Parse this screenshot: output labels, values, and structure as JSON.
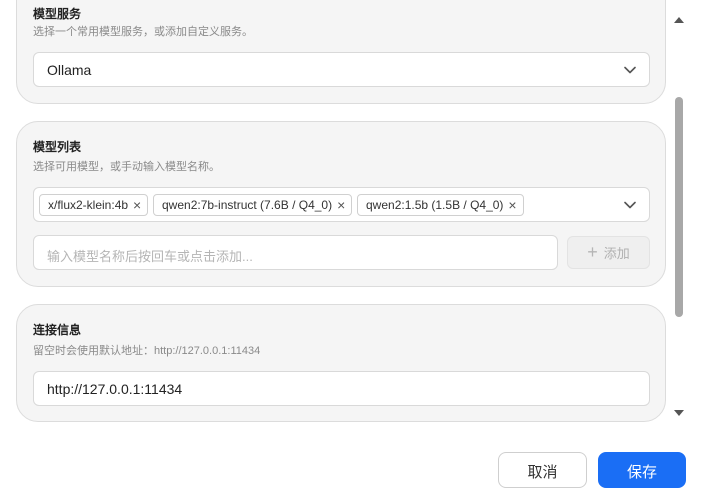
{
  "model_service": {
    "title": "模型服务",
    "description": "选择一个常用模型服务，或添加自定义服务。",
    "selected": "Ollama",
    "icon": "chevron-down-icon"
  },
  "model_list": {
    "title": "模型列表",
    "description": "选择可用模型，或手动输入模型名称。",
    "tags": [
      {
        "label": "x/flux2-klein:4b"
      },
      {
        "label": "qwen2:7b-instruct (7.6B / Q4_0)"
      },
      {
        "label": "qwen2:1.5b (1.5B / Q4_0)"
      }
    ],
    "remove_symbol": "×",
    "input_placeholder": "输入模型名称后按回车或点击添加...",
    "add_symbol": "+",
    "add_label": "添加"
  },
  "connection": {
    "title": "连接信息",
    "description": "留空时会使用默认地址：http://127.0.0.1:11434",
    "value": "http://127.0.0.1:11434"
  },
  "footer": {
    "cancel_label": "取消",
    "save_label": "保存"
  }
}
